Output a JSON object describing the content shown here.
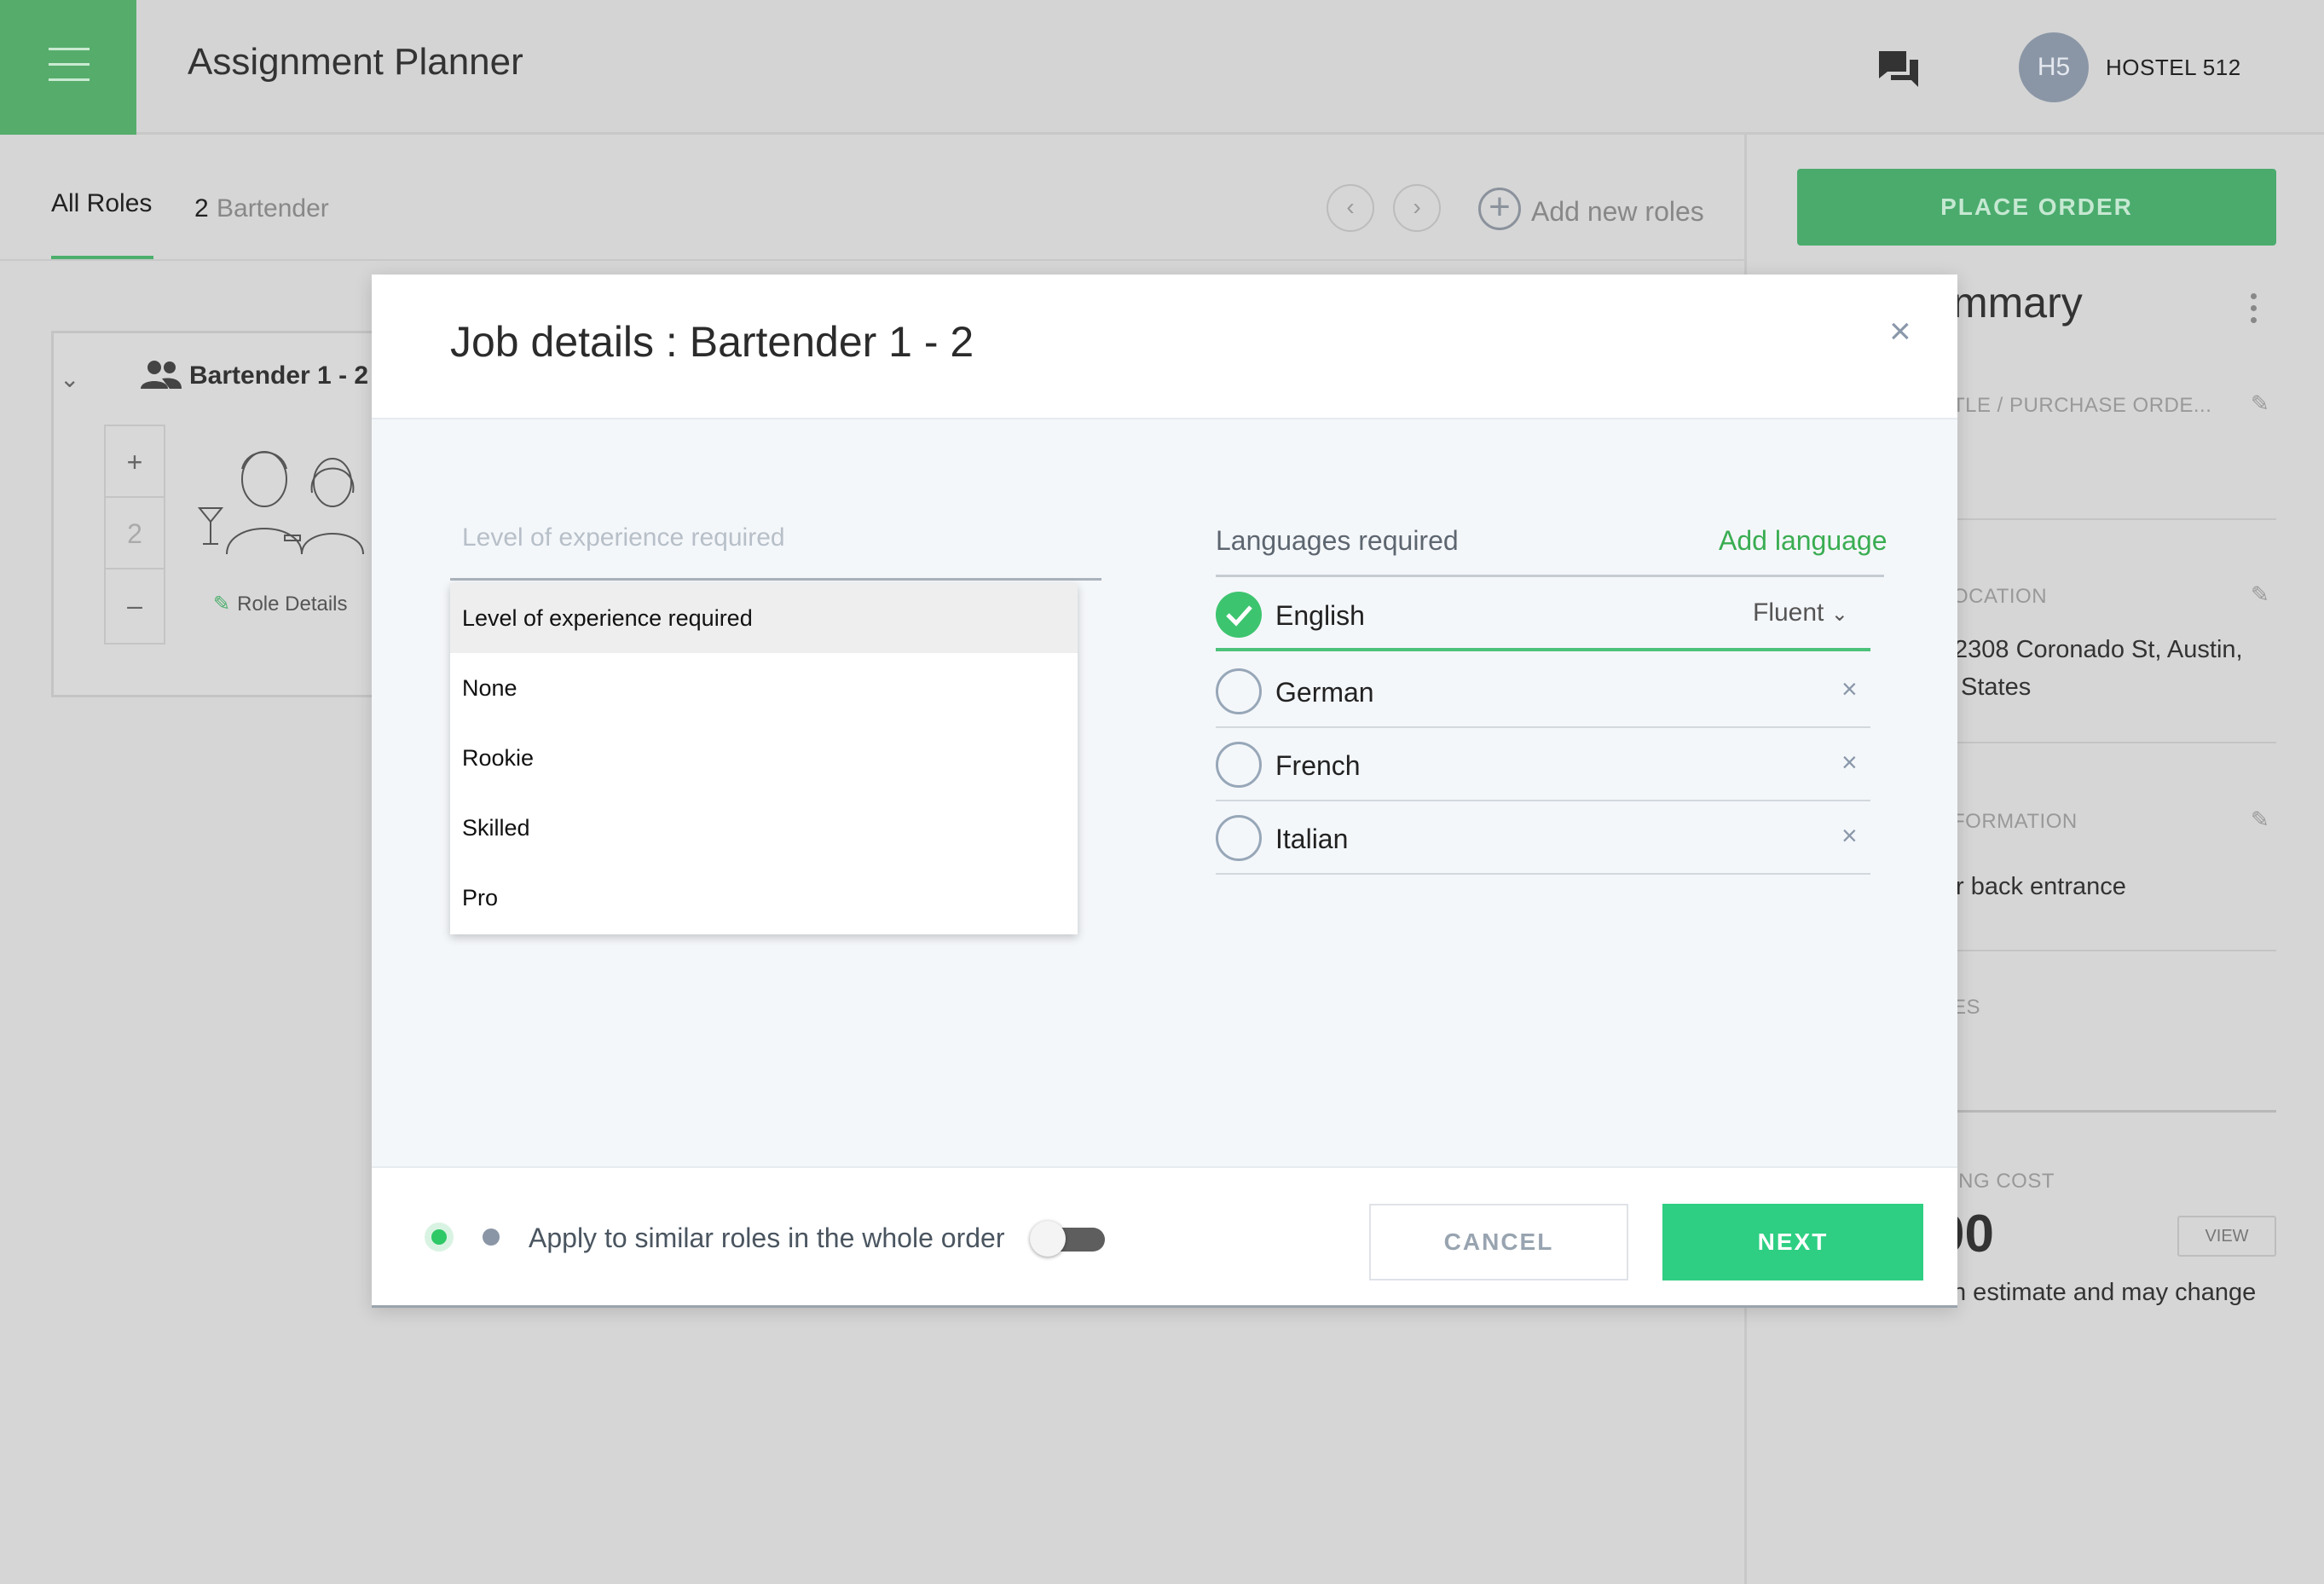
{
  "header": {
    "app_title": "Assignment Planner",
    "avatar_initials": "H5",
    "account_name": "HOSTEL 512",
    "menu_icon": "hamburger-menu-icon",
    "chat_icon": "chat-bubbles-icon",
    "accent": "#56ad6b"
  },
  "tabs": {
    "all_roles": "All Roles",
    "role_count": "2",
    "role_name": "Bartender",
    "prev": "‹",
    "next": "›",
    "add_roles": "Add new roles"
  },
  "role_card": {
    "title": "Bartender 1 - 2",
    "plus": "+",
    "count": "2",
    "minus": "–",
    "details_link": "Role Details"
  },
  "sidebar": {
    "place_order": "PLACE ORDER",
    "summary_title": "mmary",
    "sections": [
      {
        "label": "TLE / PURCHASE ORDE...",
        "text": ""
      },
      {
        "label": "OCATION",
        "text_line1": "2308 Coronado St, Austin,",
        "text_line2": "States"
      },
      {
        "label": "FORMATION",
        "text": "r back entrance"
      },
      {
        "label": "ES",
        "text": ""
      }
    ],
    "cost_label": "ING COST",
    "cost_value": "00",
    "view_button": "VIEW",
    "cost_note": "n estimate and may change"
  },
  "modal": {
    "title": "Job details : Bartender 1 - 2",
    "close": "×",
    "experience": {
      "label": "Level of experience required",
      "options": [
        "Level of experience required",
        "None",
        "Rookie",
        "Skilled",
        "Pro"
      ],
      "selected_index": 0
    },
    "languages": {
      "label": "Languages required",
      "add_label": "Add language",
      "items": [
        {
          "name": "English",
          "checked": true,
          "level": "Fluent"
        },
        {
          "name": "German",
          "checked": false
        },
        {
          "name": "French",
          "checked": false
        },
        {
          "name": "Italian",
          "checked": false
        }
      ],
      "remove": "×"
    },
    "footer": {
      "apply_text": "Apply to similar roles in the whole order",
      "toggle_on": false,
      "cancel": "CANCEL",
      "next": "NEXT",
      "next_color": "#2ecf82"
    }
  }
}
